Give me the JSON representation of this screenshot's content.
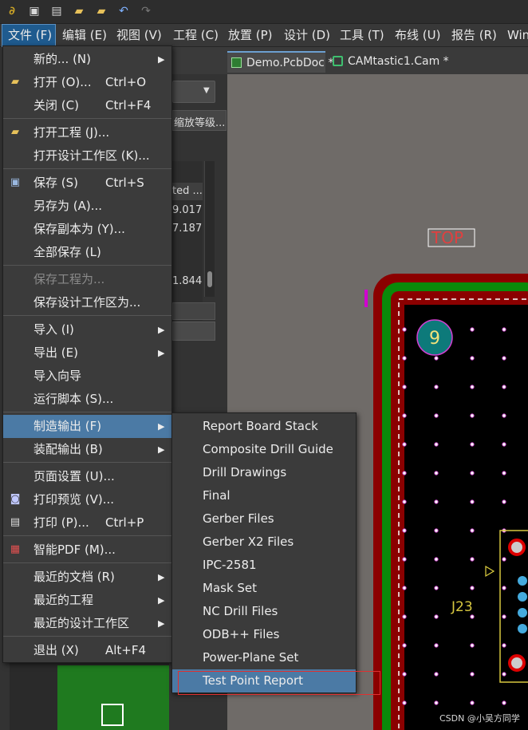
{
  "toolbar": {
    "icons": [
      "app-logo-icon",
      "save-icon",
      "save-all-icon",
      "open-folder-icon",
      "open-project-icon",
      "undo-icon",
      "redo-icon"
    ]
  },
  "menubar": {
    "items": [
      "文件 (F)",
      "编辑 (E)",
      "视图 (V)",
      "工程 (C)",
      "放置 (P)",
      "设计 (D)",
      "工具 (T)",
      "布线 (U)",
      "报告 (R)",
      "Win"
    ]
  },
  "tabs": {
    "demo": "Demo.PcbDoc *",
    "cam": "CAMtastic1.Cam *"
  },
  "panel": {
    "zoom_label": "缩放等级...",
    "col_header": "ted ...",
    "values": [
      "9.017",
      "7.187",
      "1.844"
    ]
  },
  "file_menu": {
    "items": [
      {
        "label": "新的... (N)",
        "shortcut": "",
        "arrow": "▶",
        "icon": ""
      },
      {
        "label": "打开 (O)...",
        "shortcut": "Ctrl+O",
        "arrow": "",
        "icon": "open-folder"
      },
      {
        "label": "关闭 (C)",
        "shortcut": "Ctrl+F4",
        "arrow": "",
        "icon": ""
      },
      {
        "label": "打开工程 (J)...",
        "shortcut": "",
        "arrow": "",
        "icon": "open-project"
      },
      {
        "label": "打开设计工作区 (K)...",
        "shortcut": "",
        "arrow": "",
        "icon": ""
      },
      {
        "label": "保存 (S)",
        "shortcut": "Ctrl+S",
        "arrow": "",
        "icon": "save"
      },
      {
        "label": "另存为 (A)...",
        "shortcut": "",
        "arrow": "",
        "icon": ""
      },
      {
        "label": "保存副本为 (Y)...",
        "shortcut": "",
        "arrow": "",
        "icon": ""
      },
      {
        "label": "全部保存 (L)",
        "shortcut": "",
        "arrow": "",
        "icon": ""
      },
      {
        "label": "保存工程为...",
        "shortcut": "",
        "arrow": "",
        "icon": "",
        "disabled": true
      },
      {
        "label": "保存设计工作区为...",
        "shortcut": "",
        "arrow": "",
        "icon": ""
      },
      {
        "label": "导入 (I)",
        "shortcut": "",
        "arrow": "▶",
        "icon": ""
      },
      {
        "label": "导出 (E)",
        "shortcut": "",
        "arrow": "▶",
        "icon": ""
      },
      {
        "label": "导入向导",
        "shortcut": "",
        "arrow": "",
        "icon": ""
      },
      {
        "label": "运行脚本 (S)...",
        "shortcut": "",
        "arrow": "",
        "icon": ""
      },
      {
        "label": "制造输出 (F)",
        "shortcut": "",
        "arrow": "▶",
        "icon": "",
        "highlighted": true
      },
      {
        "label": "装配输出 (B)",
        "shortcut": "",
        "arrow": "▶",
        "icon": ""
      },
      {
        "label": "页面设置 (U)...",
        "shortcut": "",
        "arrow": "",
        "icon": ""
      },
      {
        "label": "打印预览 (V)...",
        "shortcut": "",
        "arrow": "",
        "icon": "print-preview"
      },
      {
        "label": "打印 (P)...",
        "shortcut": "Ctrl+P",
        "arrow": "",
        "icon": "print"
      },
      {
        "label": "智能PDF (M)...",
        "shortcut": "",
        "arrow": "",
        "icon": "pdf"
      },
      {
        "label": "最近的文档 (R)",
        "shortcut": "",
        "arrow": "▶",
        "icon": ""
      },
      {
        "label": "最近的工程",
        "shortcut": "",
        "arrow": "▶",
        "icon": ""
      },
      {
        "label": "最近的设计工作区",
        "shortcut": "",
        "arrow": "▶",
        "icon": ""
      },
      {
        "label": "退出 (X)",
        "shortcut": "Alt+F4",
        "arrow": "",
        "icon": ""
      }
    ]
  },
  "fab_submenu": {
    "items": [
      "Report Board Stack",
      "Composite Drill Guide",
      "Drill Drawings",
      "Final",
      "Gerber Files",
      "Gerber X2 Files",
      "IPC-2581",
      "Mask Set",
      "NC Drill Files",
      "ODB++ Files",
      "Power-Plane Set",
      "Test Point Report"
    ],
    "highlighted_index": 11
  },
  "pcb": {
    "layer_label": "TOP",
    "pad_number": "9",
    "designator": "J23"
  },
  "watermark": "CSDN @小吴方同学",
  "colors": {
    "menu_bg": "#3b3b3b",
    "highlight": "#4b7aa5",
    "board_green": "#0a8a0a",
    "board_red": "#8b0000",
    "annotation_red": "#e03030"
  }
}
